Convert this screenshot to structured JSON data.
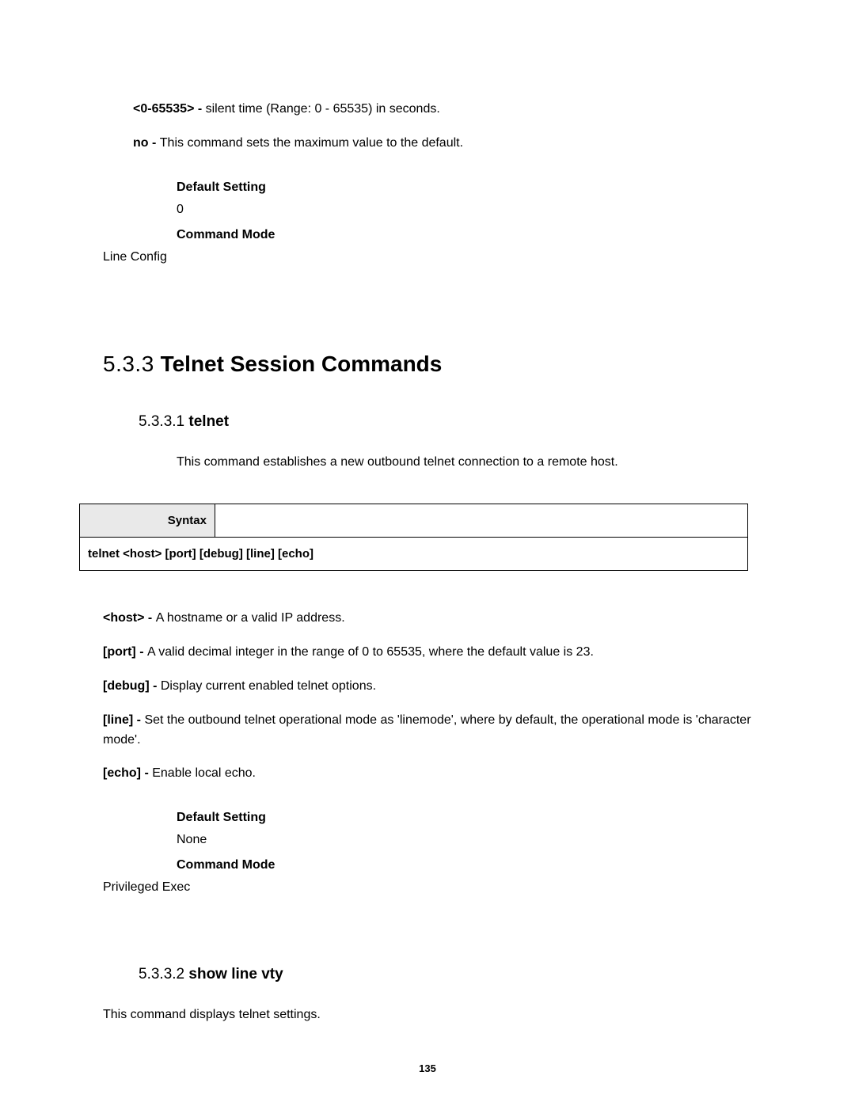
{
  "top_params": {
    "range": {
      "name": "<0-65535> - ",
      "desc": "silent time (Range: 0 - 65535) in seconds."
    },
    "no": {
      "name": "no - ",
      "desc": "This command sets the maximum value to the default."
    }
  },
  "top_block": {
    "ds_label": "Default Setting",
    "ds_value": "0",
    "cm_label": "Command Mode",
    "cm_value": "Line Config"
  },
  "section": {
    "number": "5.3.3",
    "title": "Telnet Session Commands"
  },
  "subsec1": {
    "number": "5.3.3.1",
    "name": "telnet",
    "description": "This command establishes a new outbound telnet connection to a remote host.",
    "syntax_label": "Syntax",
    "syntax_text": "telnet <host> [port] [debug] [line] [echo]",
    "params": {
      "host": {
        "name": "<host> - ",
        "desc": "A hostname or a valid IP address."
      },
      "port": {
        "name": "[port] - ",
        "desc": "A valid decimal integer in the range of 0 to 65535, where the default value is 23."
      },
      "debug": {
        "name": "[debug] - ",
        "desc": "Display current enabled telnet options."
      },
      "line": {
        "name": "[line] - ",
        "desc": "Set the outbound telnet operational mode as 'linemode', where by default, the operational mode is 'character mode'."
      },
      "echo": {
        "name": "[echo] - ",
        "desc": "Enable local echo."
      }
    },
    "ds_label": "Default Setting",
    "ds_value": "None",
    "cm_label": "Command Mode",
    "cm_value": "Privileged Exec"
  },
  "subsec2": {
    "number": "5.3.3.2",
    "name": "show line vty",
    "description": "This command displays telnet settings."
  },
  "page_number": "135"
}
